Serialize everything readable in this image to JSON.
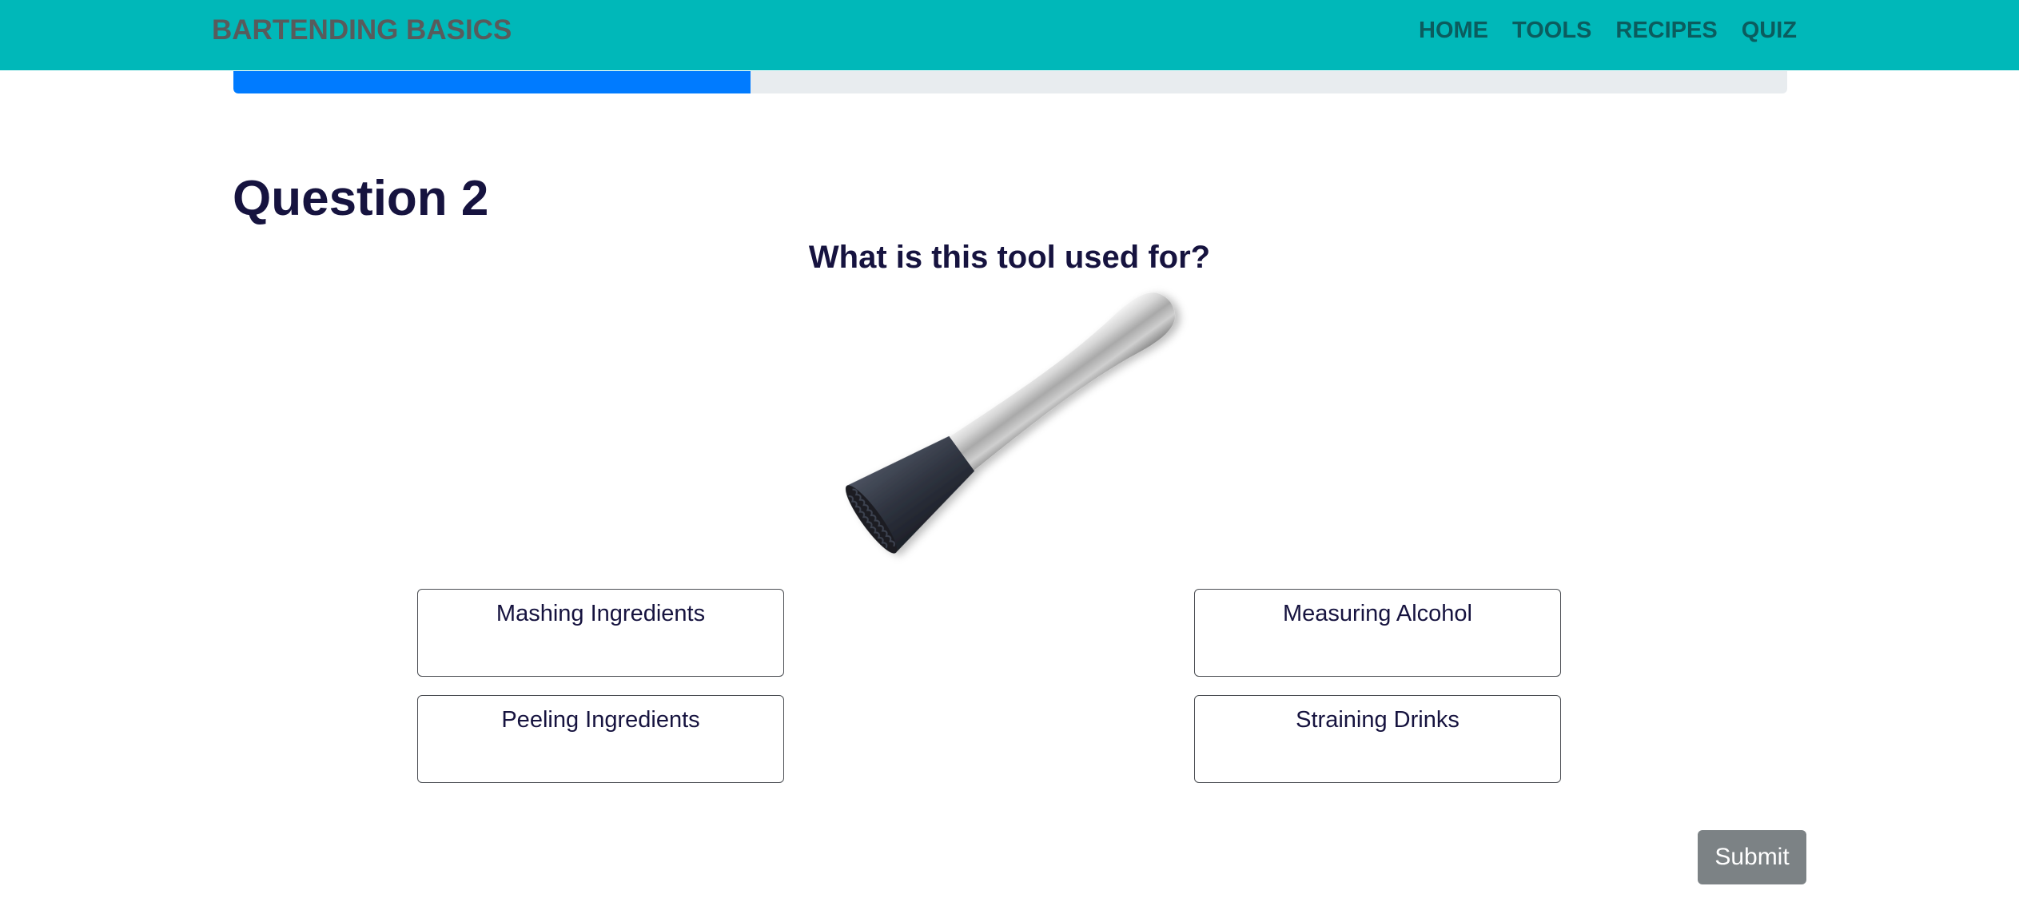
{
  "navbar": {
    "brand": "BARTENDING BASICS",
    "links": [
      {
        "label": "HOME"
      },
      {
        "label": "TOOLS"
      },
      {
        "label": "RECIPES"
      },
      {
        "label": "QUIZ"
      }
    ],
    "background_color": "#00b8b9"
  },
  "progress": {
    "percent": 33.3,
    "fill_color": "#007bff",
    "track_color": "#e8ecef"
  },
  "quiz": {
    "question_title": "Question 2",
    "question_text": "What is this tool used for?",
    "image": {
      "subject": "muddler",
      "alt": "Stainless steel cocktail muddler with black textured head"
    },
    "answers": [
      {
        "label": "Mashing Ingredients"
      },
      {
        "label": "Measuring Alcohol"
      },
      {
        "label": "Peeling Ingredients"
      },
      {
        "label": "Straining Drinks"
      }
    ],
    "submit_label": "Submit"
  }
}
